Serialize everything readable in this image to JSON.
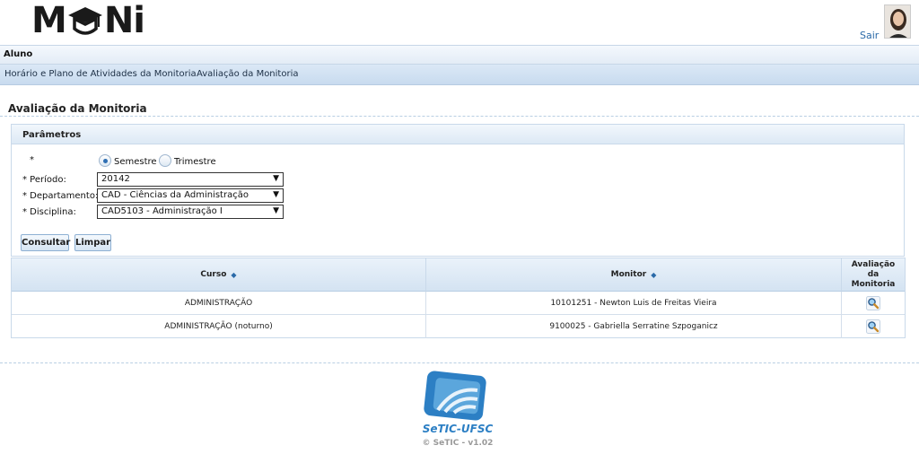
{
  "header": {
    "logo_left": "M",
    "logo_right": "Ni",
    "logout_label": "Sair"
  },
  "menu": {
    "section_title": "Aluno",
    "items": [
      {
        "label": "Horário e Plano de Atividades da Monitoria"
      },
      {
        "label": "Avaliação da Monitoria"
      }
    ]
  },
  "page": {
    "title": "Avaliação da Monitoria"
  },
  "params": {
    "panel_title": "Parâmetros",
    "type_label": "*",
    "radio_options": [
      {
        "label": "Semestre",
        "selected": true
      },
      {
        "label": "Trimestre",
        "selected": false
      }
    ],
    "periodo_label": "* Período:",
    "periodo_value": "20142",
    "departamento_label": "* Departamento:",
    "departamento_value": "CAD - Ciências da Administração",
    "disciplina_label": "* Disciplina:",
    "disciplina_value": "CAD5103 - Administração I",
    "consultar_label": "Consultar",
    "limpar_label": "Limpar"
  },
  "table": {
    "columns": {
      "curso": "Curso",
      "monitor": "Monitor",
      "avaliacao": "Avaliação da Monitoria"
    },
    "rows": [
      {
        "curso": "ADMINISTRAÇÃO",
        "monitor": "10101251 - Newton Luis de Freitas Vieira"
      },
      {
        "curso": "ADMINISTRAÇÃO (noturno)",
        "monitor": "9100025 - Gabriella Serratine Szpoganicz"
      }
    ]
  },
  "footer": {
    "org_name": "SeTIC-UFSC",
    "version": "© SeTIC - v1.02"
  },
  "colors": {
    "accent": "#2b6aa8",
    "menu_bg": "#c8dbef",
    "footer_brand": "#2c7fc4"
  }
}
